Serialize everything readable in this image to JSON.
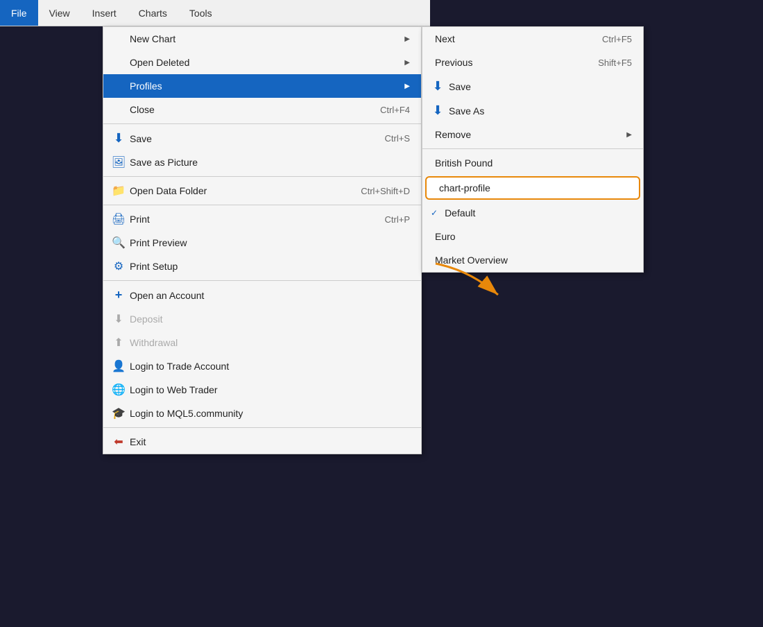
{
  "menubar": {
    "items": [
      {
        "id": "file",
        "label": "File",
        "active": true
      },
      {
        "id": "view",
        "label": "View",
        "active": false
      },
      {
        "id": "insert",
        "label": "Insert",
        "active": false
      },
      {
        "id": "charts",
        "label": "Charts",
        "active": false
      },
      {
        "id": "tools",
        "label": "Tools",
        "active": false
      }
    ]
  },
  "primary_menu": {
    "items": [
      {
        "id": "new-chart",
        "label": "New Chart",
        "shortcut": "",
        "icon": "",
        "hasArrow": true,
        "disabled": false,
        "dividerAfter": false
      },
      {
        "id": "open-deleted",
        "label": "Open Deleted",
        "shortcut": "",
        "icon": "",
        "hasArrow": true,
        "disabled": false,
        "dividerAfter": false
      },
      {
        "id": "profiles",
        "label": "Profiles",
        "shortcut": "",
        "icon": "",
        "hasArrow": true,
        "disabled": false,
        "active": true,
        "dividerAfter": false
      },
      {
        "id": "close",
        "label": "Close",
        "shortcut": "Ctrl+F4",
        "icon": "",
        "hasArrow": false,
        "disabled": false,
        "dividerAfter": true
      },
      {
        "id": "save",
        "label": "Save",
        "shortcut": "Ctrl+S",
        "icon": "⬇",
        "hasArrow": false,
        "disabled": false,
        "dividerAfter": false
      },
      {
        "id": "save-as-picture",
        "label": "Save as Picture",
        "shortcut": "",
        "icon": "🖼",
        "hasArrow": false,
        "disabled": false,
        "dividerAfter": true
      },
      {
        "id": "open-data-folder",
        "label": "Open Data Folder",
        "shortcut": "Ctrl+Shift+D",
        "icon": "📁",
        "hasArrow": false,
        "disabled": false,
        "dividerAfter": true
      },
      {
        "id": "print",
        "label": "Print",
        "shortcut": "Ctrl+P",
        "icon": "🖨",
        "hasArrow": false,
        "disabled": false,
        "dividerAfter": false
      },
      {
        "id": "print-preview",
        "label": "Print Preview",
        "shortcut": "",
        "icon": "🔍",
        "hasArrow": false,
        "disabled": false,
        "dividerAfter": false
      },
      {
        "id": "print-setup",
        "label": "Print Setup",
        "shortcut": "",
        "icon": "⚙",
        "hasArrow": false,
        "disabled": false,
        "dividerAfter": true
      },
      {
        "id": "open-account",
        "label": "Open an Account",
        "shortcut": "",
        "icon": "+",
        "hasArrow": false,
        "disabled": false,
        "dividerAfter": false
      },
      {
        "id": "deposit",
        "label": "Deposit",
        "shortcut": "",
        "icon": "⬇",
        "hasArrow": false,
        "disabled": true,
        "dividerAfter": false
      },
      {
        "id": "withdrawal",
        "label": "Withdrawal",
        "shortcut": "",
        "icon": "⬆",
        "hasArrow": false,
        "disabled": true,
        "dividerAfter": false
      },
      {
        "id": "login-trade",
        "label": "Login to Trade Account",
        "shortcut": "",
        "icon": "👤",
        "hasArrow": false,
        "disabled": false,
        "dividerAfter": false
      },
      {
        "id": "login-web",
        "label": "Login to Web Trader",
        "shortcut": "",
        "icon": "🌐",
        "hasArrow": false,
        "disabled": false,
        "dividerAfter": false
      },
      {
        "id": "login-mql5",
        "label": "Login to MQL5.community",
        "shortcut": "",
        "icon": "🎓",
        "hasArrow": false,
        "disabled": false,
        "dividerAfter": true
      },
      {
        "id": "exit",
        "label": "Exit",
        "shortcut": "",
        "icon": "⬅",
        "hasArrow": false,
        "disabled": false,
        "dividerAfter": false
      }
    ]
  },
  "secondary_menu": {
    "items": [
      {
        "id": "next",
        "label": "Next",
        "shortcut": "Ctrl+F5",
        "hasArrow": false,
        "highlighted": false,
        "checkmark": false
      },
      {
        "id": "previous",
        "label": "Previous",
        "shortcut": "Shift+F5",
        "hasArrow": false,
        "highlighted": false,
        "checkmark": false
      },
      {
        "id": "save-profile",
        "label": "Save",
        "shortcut": "",
        "icon": "⬇",
        "hasArrow": false,
        "highlighted": false,
        "checkmark": false
      },
      {
        "id": "save-as-profile",
        "label": "Save As",
        "shortcut": "",
        "icon": "⬇",
        "hasArrow": false,
        "highlighted": false,
        "checkmark": false
      },
      {
        "id": "remove",
        "label": "Remove",
        "shortcut": "",
        "hasArrow": true,
        "highlighted": false,
        "checkmark": false,
        "dividerAfter": true
      },
      {
        "id": "british-pound",
        "label": "British Pound",
        "shortcut": "",
        "hasArrow": false,
        "highlighted": false,
        "checkmark": false
      },
      {
        "id": "chart-profile",
        "label": "chart-profile",
        "shortcut": "",
        "hasArrow": false,
        "highlighted": true,
        "checkmark": false
      },
      {
        "id": "default",
        "label": "Default",
        "shortcut": "",
        "hasArrow": false,
        "highlighted": false,
        "checkmark": true
      },
      {
        "id": "euro",
        "label": "Euro",
        "shortcut": "",
        "hasArrow": false,
        "highlighted": false,
        "checkmark": false
      },
      {
        "id": "market-overview",
        "label": "Market Overview",
        "shortcut": "",
        "hasArrow": false,
        "highlighted": false,
        "checkmark": false
      }
    ]
  }
}
